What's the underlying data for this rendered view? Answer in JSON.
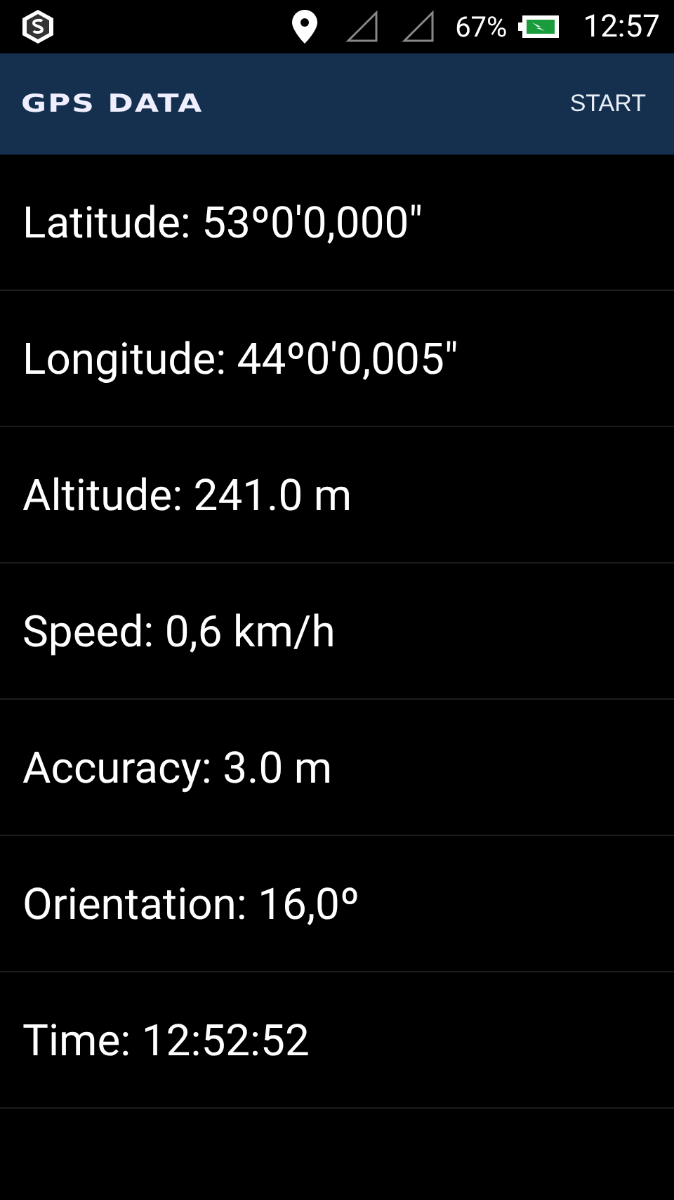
{
  "status_bar": {
    "battery": "67%",
    "time": "12:57"
  },
  "app_bar": {
    "title": "GPS DATA",
    "action": "START"
  },
  "readings": [
    {
      "text": "Latitude: 53º0'0,000\""
    },
    {
      "text": "Longitude: 44º0'0,005\""
    },
    {
      "text": "Altitude: 241.0 m"
    },
    {
      "text": "Speed: 0,6 km/h"
    },
    {
      "text": "Accuracy: 3.0 m"
    },
    {
      "text": "Orientation: 16,0º"
    },
    {
      "text": "Time: 12:52:52"
    }
  ]
}
